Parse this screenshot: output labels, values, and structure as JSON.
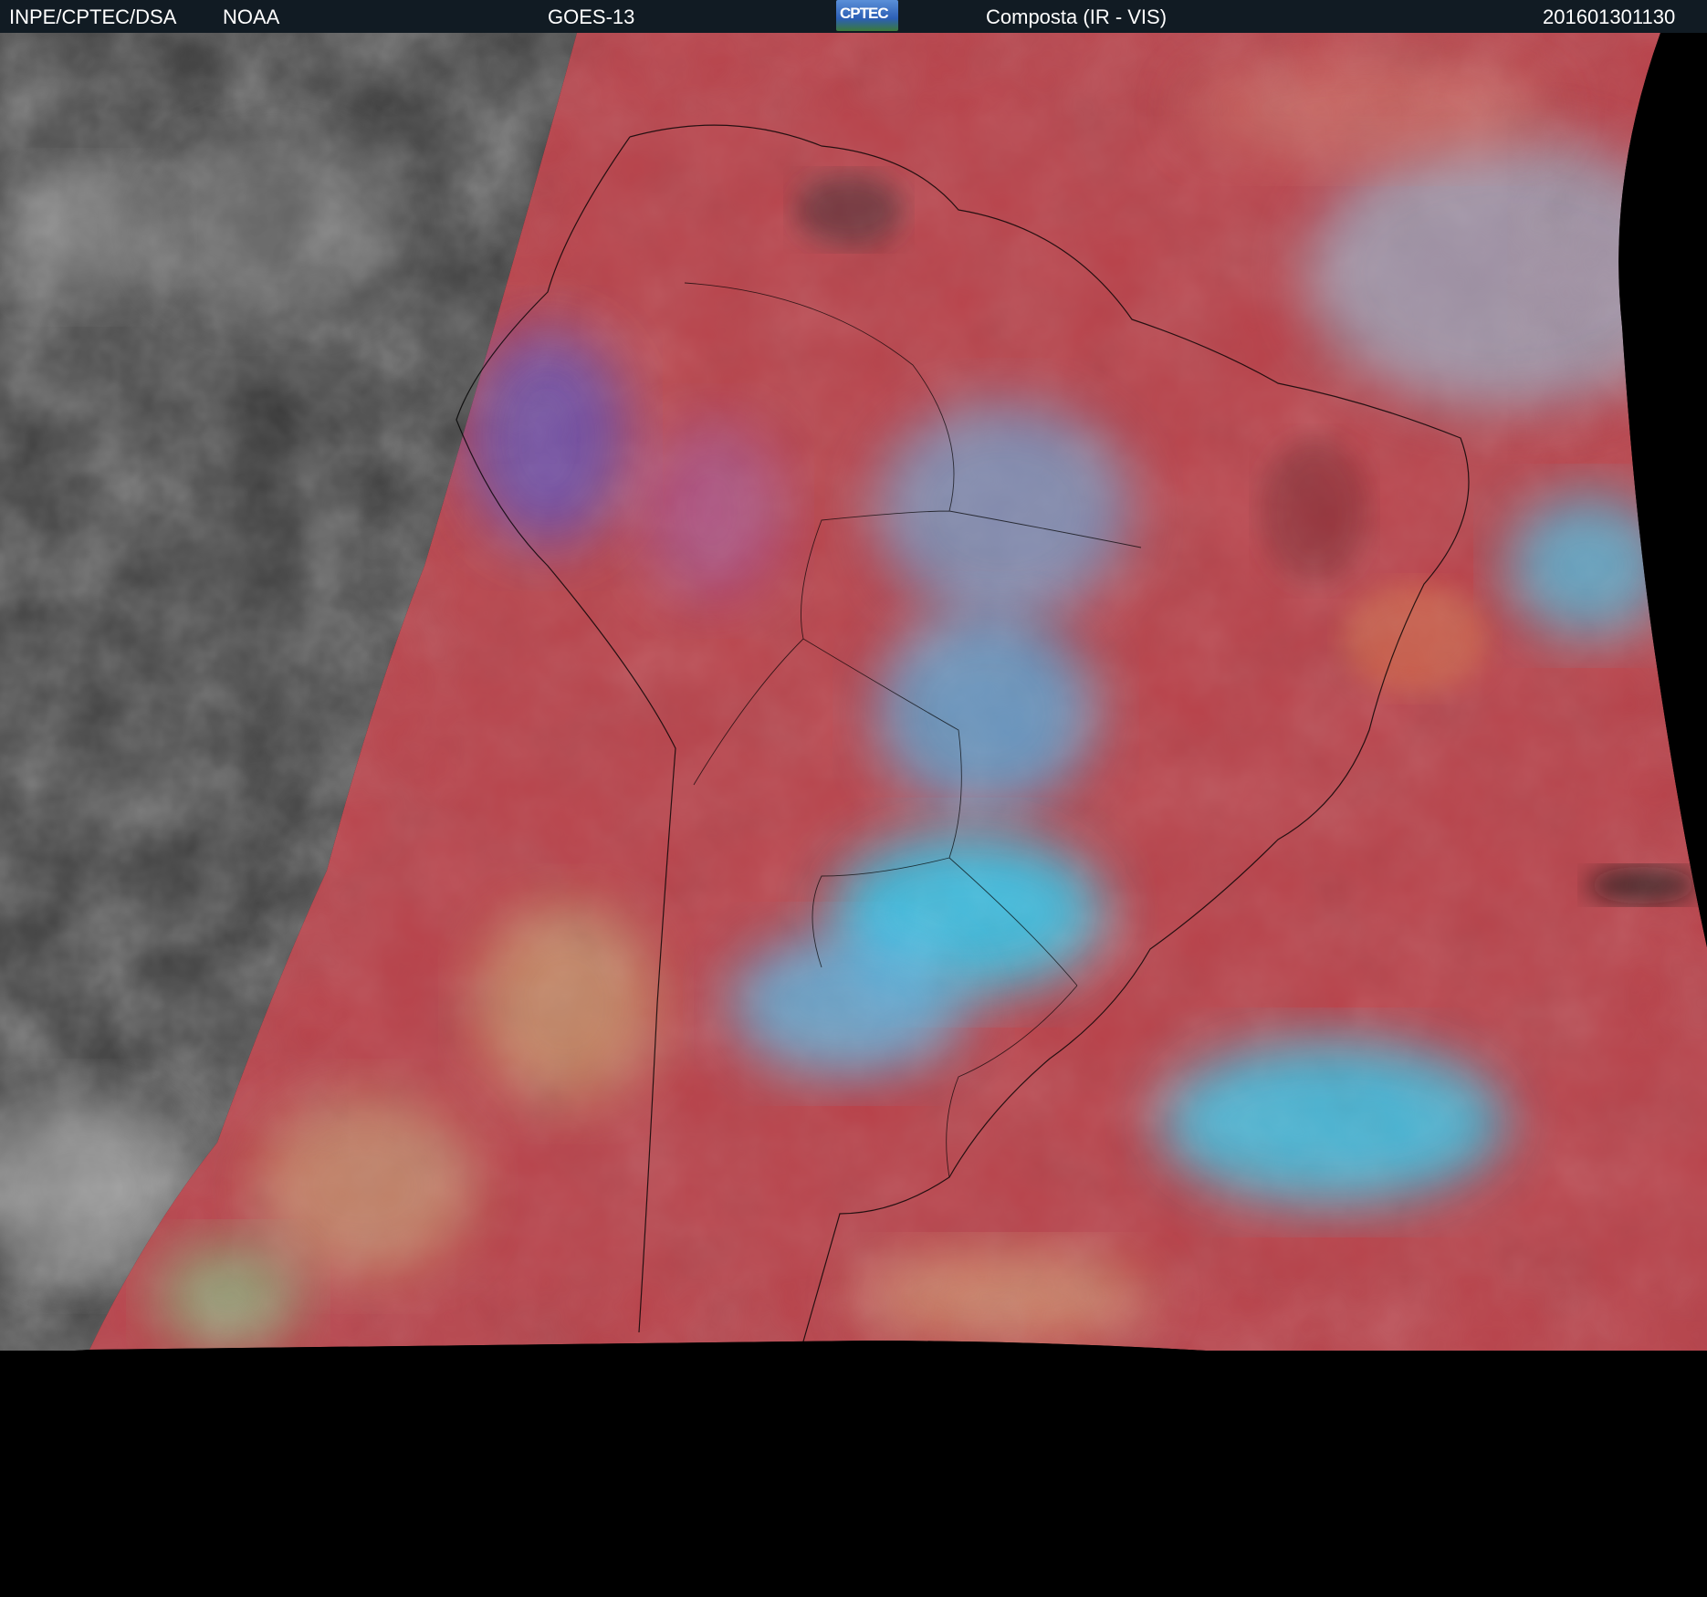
{
  "header": {
    "institution": "INPE/CPTEC/DSA",
    "agency": "NOAA",
    "satellite": "GOES-13",
    "logo_text": "CPTEC",
    "product": "Composta (IR - VIS)",
    "timestamp": "201601301130"
  },
  "colors": {
    "header_bg": "#111b23",
    "land_clear": "#b8424a",
    "cloud_cyan": "#2fd0f5",
    "ir_gray": "#3a3a3a"
  }
}
